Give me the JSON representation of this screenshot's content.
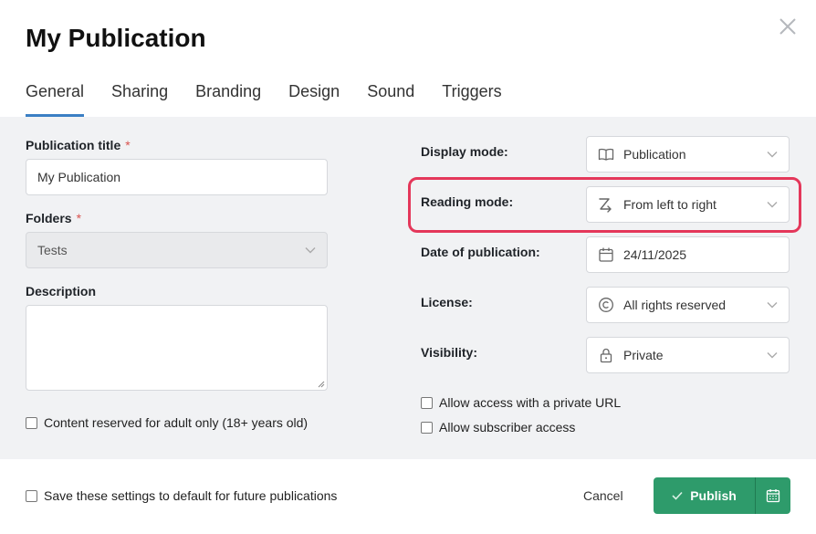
{
  "dialog": {
    "title": "My Publication"
  },
  "tabs": [
    {
      "label": "General"
    },
    {
      "label": "Sharing"
    },
    {
      "label": "Branding"
    },
    {
      "label": "Design"
    },
    {
      "label": "Sound"
    },
    {
      "label": "Triggers"
    }
  ],
  "left": {
    "title_label": "Publication title",
    "required_mark": "*",
    "title_value": "My Publication",
    "folders_label": "Folders",
    "folders_value": "Tests",
    "description_label": "Description",
    "description_value": "",
    "adult_label": "Content reserved for adult only (18+ years old)"
  },
  "right": {
    "display_mode_label": "Display mode:",
    "display_mode_value": "Publication",
    "reading_mode_label": "Reading mode:",
    "reading_mode_value": "From left to right",
    "date_label": "Date of publication:",
    "date_value": "24/11/2025",
    "license_label": "License:",
    "license_value": "All rights reserved",
    "visibility_label": "Visibility:",
    "visibility_value": "Private",
    "private_url_label": "Allow access with a private URL",
    "subscriber_label": "Allow subscriber access"
  },
  "footer": {
    "save_default_label": "Save these settings to default for future publications",
    "cancel_label": "Cancel",
    "publish_label": "Publish"
  },
  "colors": {
    "accent": "#3b7fc4",
    "publish": "#2e9b6b",
    "highlight": "#e4375a",
    "required": "#d9534f"
  }
}
